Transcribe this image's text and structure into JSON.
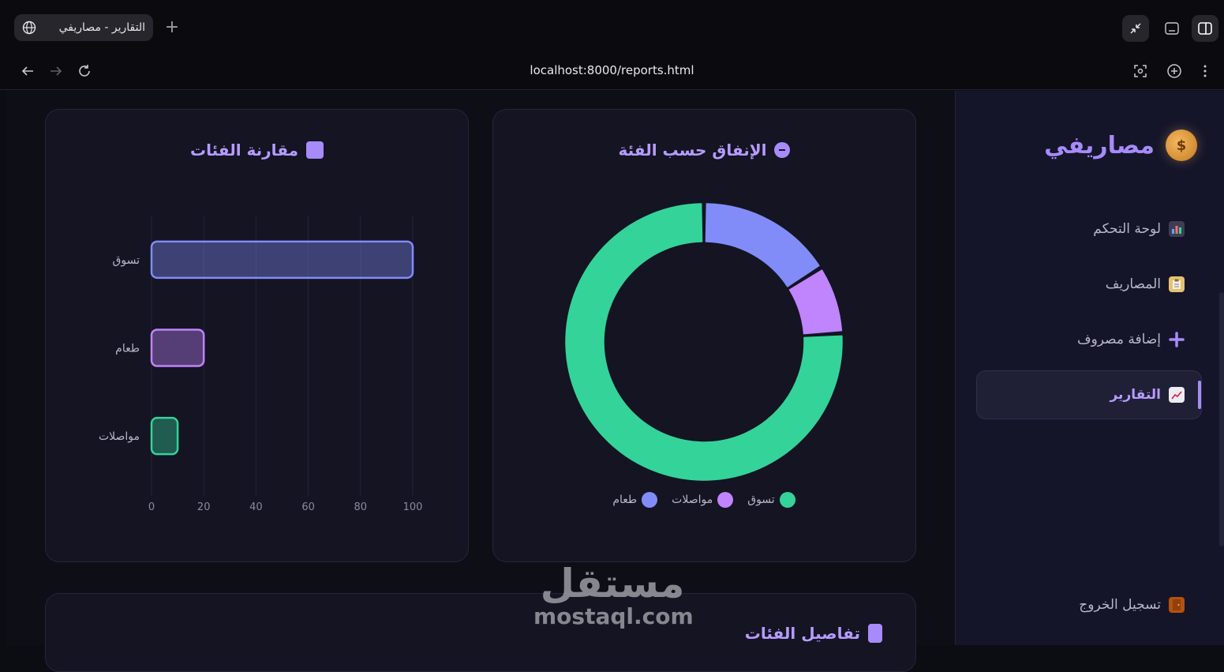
{
  "browser": {
    "tab_title": "التقارير - مصاريفي",
    "new_tab": "+",
    "url": "localhost:8000/reports.html"
  },
  "sidebar": {
    "brand": "مصاريفي",
    "brand_icon": "money-bag-icon",
    "items": [
      {
        "label": "لوحة التحكم",
        "icon": "bar-chart-icon"
      },
      {
        "label": "المصاريف",
        "icon": "clipboard-icon"
      },
      {
        "label": "إضافة مصروف",
        "icon": "plus-icon"
      },
      {
        "label": "التقارير",
        "icon": "trend-chart-icon",
        "active": true
      }
    ],
    "logout": {
      "label": "تسجيل الخروج",
      "icon": "door-icon"
    }
  },
  "cards": {
    "bar_title": "مقارنة الفئات",
    "donut_title": "الإنفاق حسب الفئة",
    "details_title": "تفاصيل الفئات"
  },
  "watermark": {
    "arabic": "مستقل",
    "latin": "mostaql.com"
  },
  "colors": {
    "accent": "#a78bfa",
    "shopping": "#34d399",
    "transport": "#c084fc",
    "food": "#818cf8"
  },
  "chart_data": [
    {
      "type": "bar",
      "orientation": "horizontal",
      "title": "مقارنة الفئات",
      "categories": [
        "تسوق",
        "طعام",
        "مواصلات"
      ],
      "values": [
        100,
        20,
        10
      ],
      "colors": [
        "#818cf8",
        "#c084fc",
        "#34d399"
      ],
      "xlim": [
        0,
        100
      ],
      "xticks": [
        0,
        20,
        40,
        60,
        80,
        100
      ],
      "grid": true
    },
    {
      "type": "pie",
      "donut": true,
      "title": "الإنفاق حسب الفئة",
      "labels": [
        "تسوق",
        "مواصلات",
        "طعام"
      ],
      "values": [
        76,
        8,
        16
      ],
      "colors": [
        "#34d399",
        "#c084fc",
        "#818cf8"
      ],
      "legend": "bottom"
    }
  ]
}
